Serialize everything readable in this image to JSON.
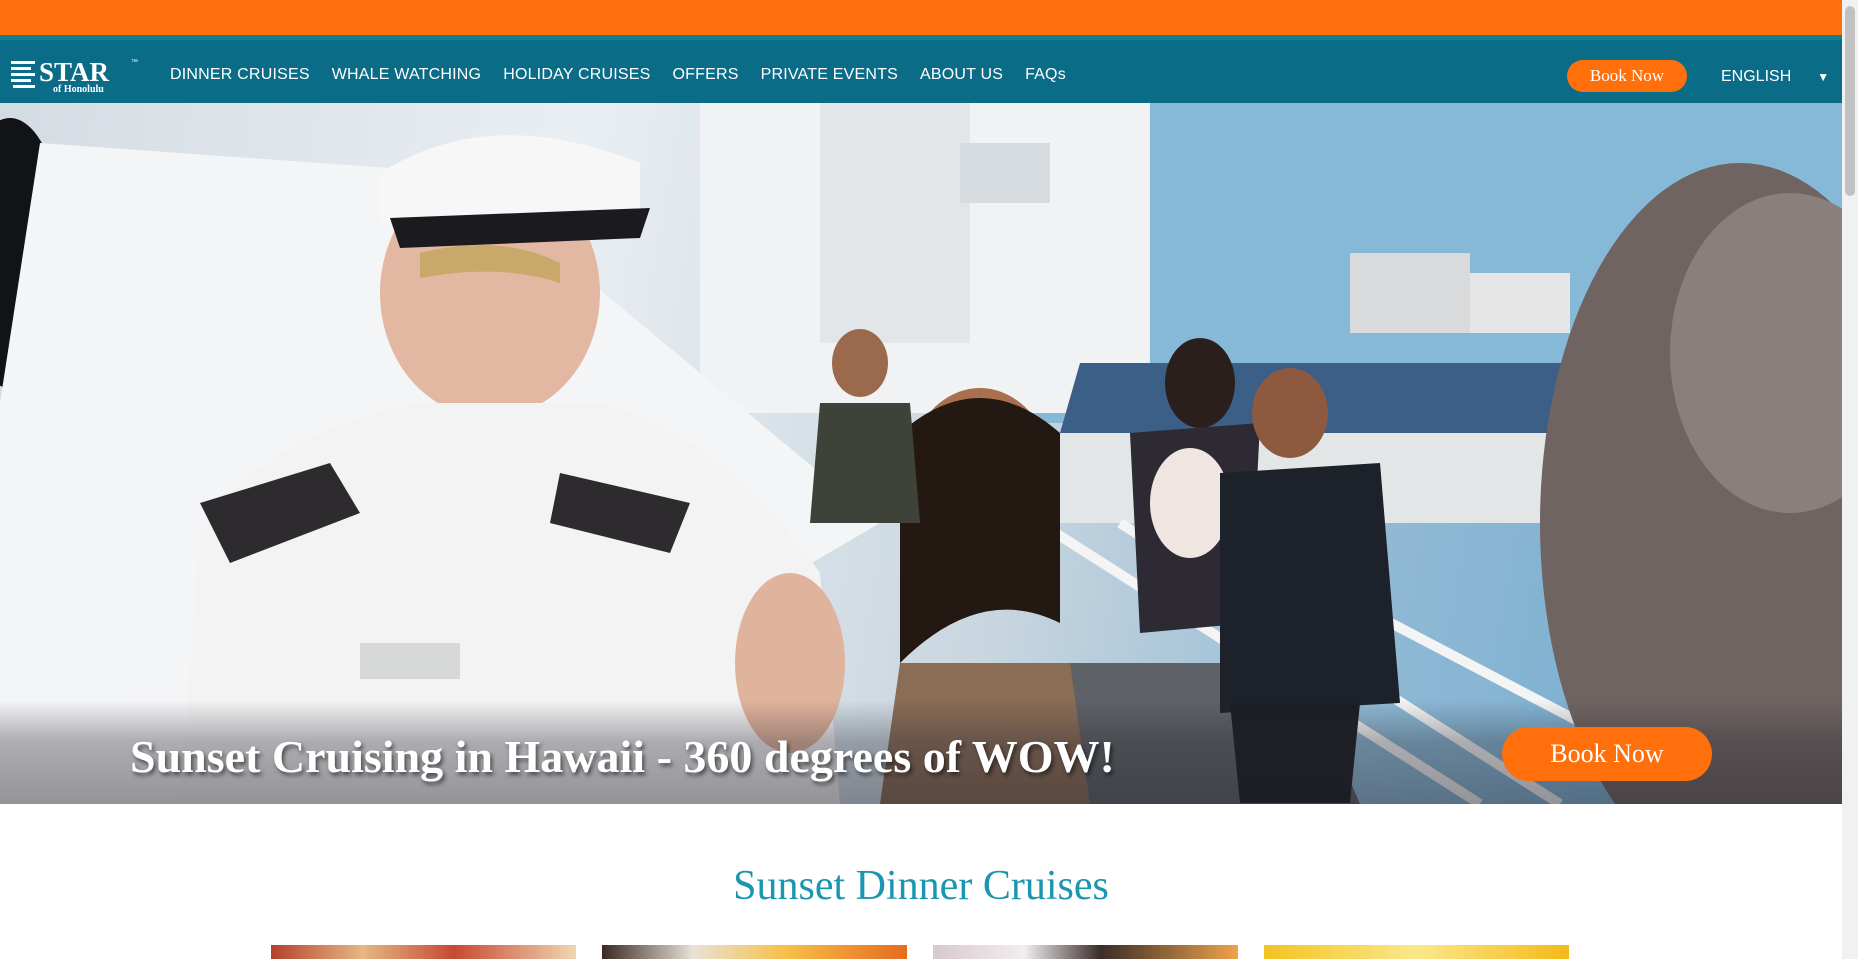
{
  "brand": {
    "logo_text": "STAR",
    "logo_sub": "of Honolulu",
    "logo_tm": "™",
    "accent_orange": "#ff6f0c",
    "nav_teal": "#0b6c88",
    "title_teal": "#1a96b0"
  },
  "nav": {
    "items": [
      {
        "label": "DINNER CRUISES"
      },
      {
        "label": "WHALE WATCHING"
      },
      {
        "label": "HOLIDAY CRUISES"
      },
      {
        "label": "OFFERS"
      },
      {
        "label": "PRIVATE EVENTS"
      },
      {
        "label": "ABOUT US"
      },
      {
        "label": "FAQs"
      }
    ],
    "book_label": "Book Now",
    "language": "ENGLISH",
    "language_icon": "caret-down-icon"
  },
  "hero": {
    "title": "Sunset Cruising in Hawaii - 360 degrees of WOW!",
    "book_label": "Book Now"
  },
  "section": {
    "title": "Sunset Dinner Cruises"
  }
}
